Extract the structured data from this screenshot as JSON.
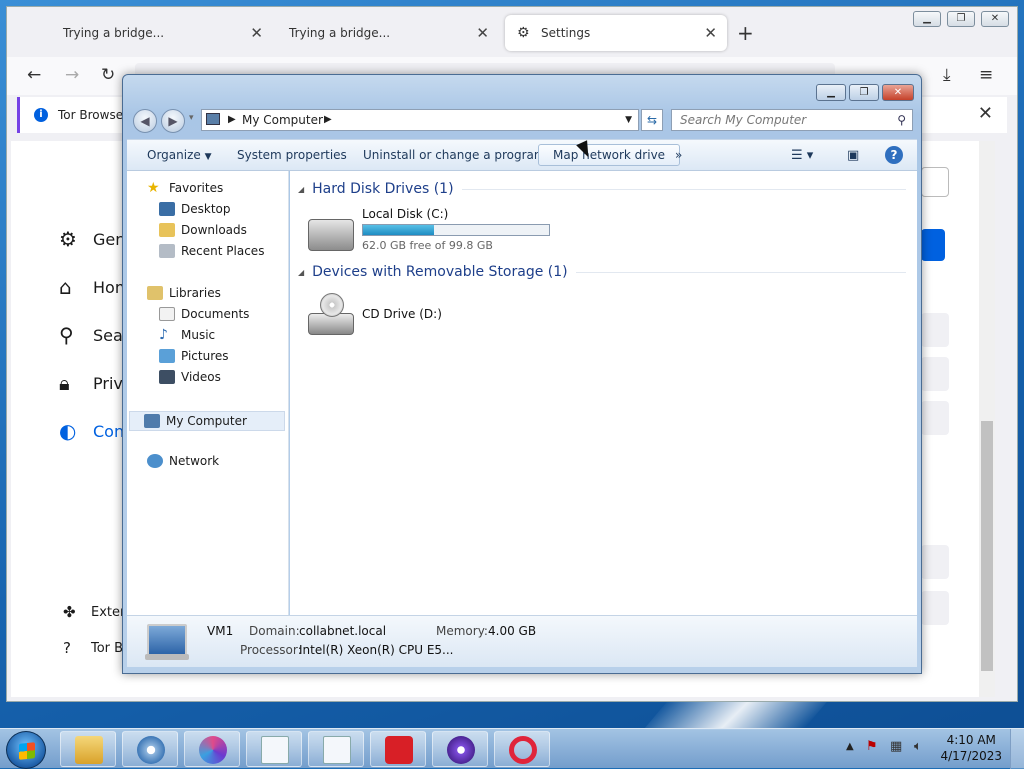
{
  "browser": {
    "tabs": [
      {
        "label": "Trying a bridge..."
      },
      {
        "label": "Trying a bridge..."
      },
      {
        "label": "Settings"
      }
    ],
    "notification": "Tor Browser",
    "sidebar": [
      {
        "label": "Gene",
        "icon": "gear-icon"
      },
      {
        "label": "Hom",
        "icon": "home-icon"
      },
      {
        "label": "Sear",
        "icon": "search-icon"
      },
      {
        "label": "Priva",
        "icon": "lock-icon"
      },
      {
        "label": "Conn",
        "icon": "tor-onion-icon"
      }
    ],
    "sidebar_bottom": [
      {
        "label": "Exten",
        "icon": "puzzle-icon"
      },
      {
        "label": "Tor Br",
        "icon": "help-icon"
      }
    ]
  },
  "explorer": {
    "address": "My Computer",
    "search_placeholder": "Search My Computer",
    "commands": {
      "organize": "Organize",
      "system_properties": "System properties",
      "uninstall": "Uninstall or change a program",
      "map_drive": "Map network drive",
      "more": "»"
    },
    "nav": {
      "favorites": "Favorites",
      "desktop": "Desktop",
      "downloads": "Downloads",
      "recent": "Recent Places",
      "libraries": "Libraries",
      "documents": "Documents",
      "music": "Music",
      "pictures": "Pictures",
      "videos": "Videos",
      "computer": "My Computer",
      "network": "Network"
    },
    "groups": {
      "hdd": "Hard Disk Drives (1)",
      "removable": "Devices with Removable Storage (1)"
    },
    "drives": {
      "c_name": "Local Disk (C:)",
      "c_free": "62.0 GB free of 99.8 GB",
      "c_used_fraction": 0.38,
      "d_name": "CD Drive (D:)"
    },
    "details": {
      "name": "VM1",
      "domain_label": "Domain:",
      "domain": "collabnet.local",
      "memory_label": "Memory:",
      "memory": "4.00 GB",
      "processor_label": "Processor:",
      "processor": "Intel(R) Xeon(R) CPU E5..."
    }
  },
  "taskbar": {
    "time": "4:10 AM",
    "date": "4/17/2023"
  }
}
